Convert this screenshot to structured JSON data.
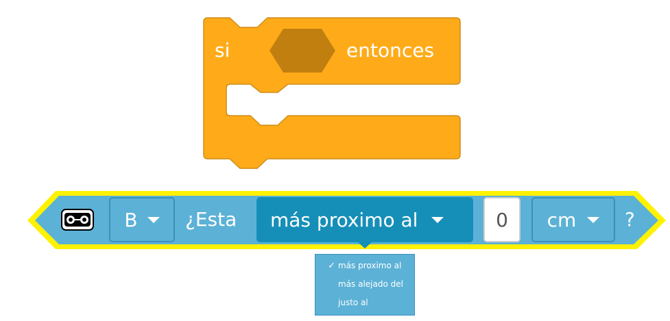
{
  "if_block": {
    "label_if": "si",
    "label_then": "entonces",
    "color": "#ffab19",
    "border_color": "#cf8b17",
    "slot_color": "#c17f0f"
  },
  "sensor_block": {
    "port": "B",
    "question_prefix": "¿Esta",
    "comparison": "más proximo al",
    "distance_value": "0",
    "unit": "cm",
    "question_suffix": "?",
    "color": "#5cb1d6",
    "highlight_color": "#fff200",
    "selected_field_color": "#168fb8"
  },
  "dropdown": {
    "items": [
      {
        "label": "más proximo al",
        "checked": true,
        "check": "✓"
      },
      {
        "label": "más alejado del",
        "checked": false,
        "check": ""
      },
      {
        "label": "justo al",
        "checked": false,
        "check": ""
      }
    ]
  }
}
